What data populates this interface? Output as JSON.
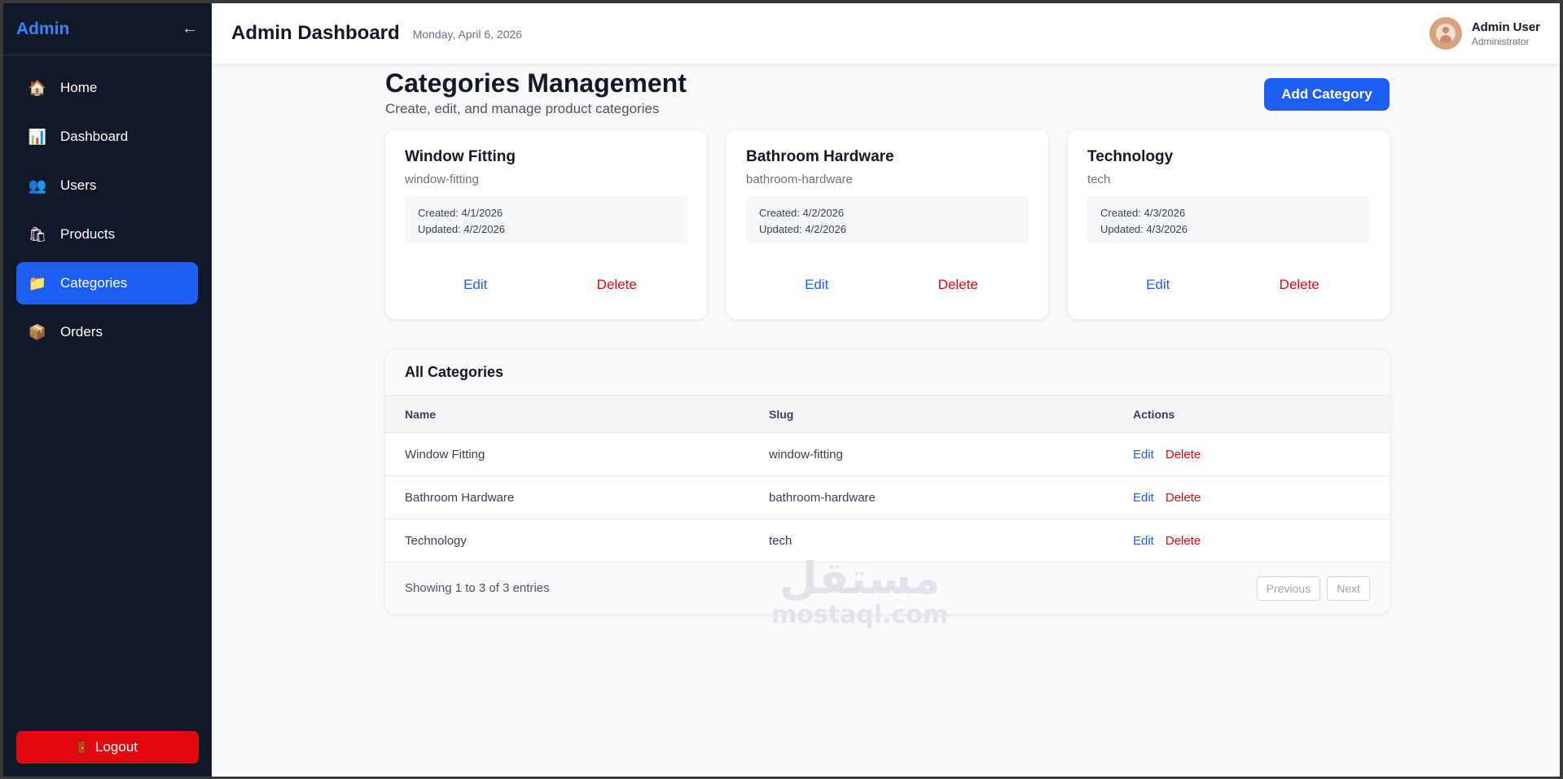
{
  "sidebar": {
    "brand": "Admin",
    "collapse_icon": "←",
    "items": [
      {
        "label": "Home",
        "icon": "🏠"
      },
      {
        "label": "Dashboard",
        "icon": "📊"
      },
      {
        "label": "Users",
        "icon": "👥"
      },
      {
        "label": "Products",
        "icon": "🛍"
      },
      {
        "label": "Categories",
        "icon": "📁",
        "active": true
      },
      {
        "label": "Orders",
        "icon": "📦"
      }
    ],
    "logout_label": "Logout"
  },
  "header": {
    "title": "Admin Dashboard",
    "date": "Monday, April 6, 2026",
    "user_name": "Admin User",
    "user_role": "Administrator"
  },
  "page": {
    "title": "Categories Management",
    "subtitle": "Create, edit, and manage product categories",
    "add_button": "Add Category"
  },
  "cards": [
    {
      "name": "Window Fitting",
      "slug": "window-fitting",
      "created": "Created: 4/1/2026",
      "updated": "Updated: 4/2/2026",
      "edit": "Edit",
      "delete": "Delete"
    },
    {
      "name": "Bathroom Hardware",
      "slug": "bathroom-hardware",
      "created": "Created: 4/2/2026",
      "updated": "Updated: 4/2/2026",
      "edit": "Edit",
      "delete": "Delete"
    },
    {
      "name": "Technology",
      "slug": "tech",
      "created": "Created: 4/3/2026",
      "updated": "Updated: 4/3/2026",
      "edit": "Edit",
      "delete": "Delete"
    }
  ],
  "table": {
    "title": "All Categories",
    "columns": [
      "Name",
      "Slug",
      "Actions"
    ],
    "rows": [
      {
        "name": "Window Fitting",
        "slug": "window-fitting",
        "edit": "Edit",
        "delete": "Delete"
      },
      {
        "name": "Bathroom Hardware",
        "slug": "bathroom-hardware",
        "edit": "Edit",
        "delete": "Delete"
      },
      {
        "name": "Technology",
        "slug": "tech",
        "edit": "Edit",
        "delete": "Delete"
      }
    ],
    "footer_text": "Showing 1 to 3 of 3 entries",
    "prev_label": "Previous",
    "next_label": "Next"
  },
  "watermark": {
    "arabic": "مستقل",
    "latin": "mostaql.com"
  },
  "colors": {
    "sidebar_bg": "#111827",
    "accent": "#1d5ff5",
    "danger": "#dc0a12",
    "logout_bg": "#e3080f"
  }
}
